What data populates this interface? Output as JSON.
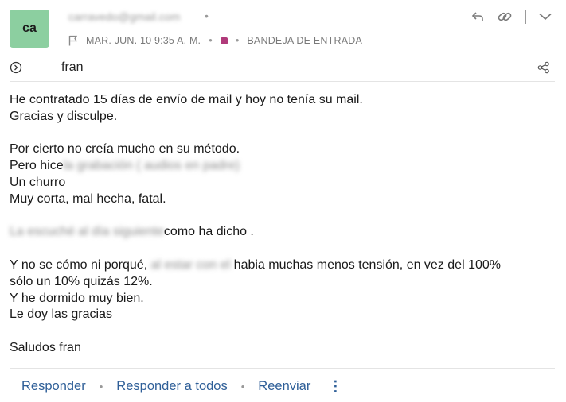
{
  "header": {
    "avatar_initials": "ca",
    "avatar_color": "#8ccfa0",
    "sender_email": "carravedo@gmail.com",
    "date": "MAR. JUN. 10 9:35 A. M.",
    "label_color": "#b03a7a",
    "folder": "BANDEJA DE ENTRADA",
    "icons": [
      "reply-icon",
      "link-icon",
      "chevron-down-icon",
      "flag-icon"
    ]
  },
  "subject_row": {
    "to_name": "fran",
    "icons": [
      "expand-icon",
      "share-icon"
    ]
  },
  "body": {
    "line1": "He contratado 15 días de envío de mail y hoy no tenía su mail.",
    "line2": "Gracias y disculpe.",
    "line3": "Por cierto no creía mucho en su método.",
    "line4_prefix": "Pero hice",
    "line4_blurred": "la grabación ( audios en padre)",
    "line5": "Un churro",
    "line6": "Muy corta, mal hecha, fatal.",
    "line7_blurred": "La escuché al día siguiente",
    "line7_suffix": "como ha dicho .",
    "line8_prefix": "Y no se cómo ni porqué,",
    "line8_blurred": "al estar con el",
    "line8_suffix": "habia muchas menos tensión, en vez del 100%",
    "line9": "sólo un 10% quizás 12%.",
    "line10": "Y he dormido muy bien.",
    "line11": "Le doy las gracias",
    "line12": "Saludos fran"
  },
  "actions": {
    "reply": "Responder",
    "reply_all": "Responder a todos",
    "forward": "Reenviar",
    "accent_color": "#2f5f98"
  }
}
